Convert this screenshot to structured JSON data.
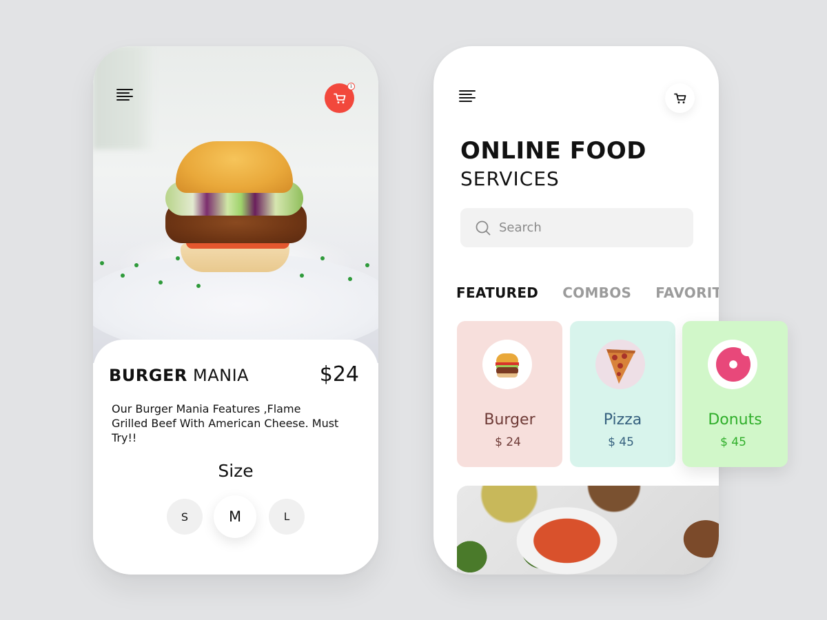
{
  "detail_screen": {
    "menu_icon": "hamburger-menu-icon",
    "cart_icon": "shopping-cart-icon",
    "cart_count": "1",
    "product": {
      "title_bold": "BURGER",
      "title_light": "MANIA",
      "price": "$24",
      "description": "Our Burger Mania Features ,Flame Grilled Beef With American Cheese. Must Try!!"
    },
    "size": {
      "label": "Size",
      "options": [
        "S",
        "M",
        "L"
      ],
      "selected": "M"
    }
  },
  "home_screen": {
    "menu_icon": "hamburger-menu-icon",
    "cart_icon": "shopping-cart-icon",
    "headline_bold": "ONLINE FOOD",
    "headline_light": "SERVICES",
    "search": {
      "placeholder": "Search",
      "value": ""
    },
    "tabs": [
      {
        "label": "FEATURED",
        "active": true
      },
      {
        "label": "COMBOS",
        "active": false
      },
      {
        "label": "FAVORITES",
        "active": false
      }
    ],
    "categories": [
      {
        "name": "Burger",
        "price": "$ 24",
        "bg": "#f7dfdc",
        "color": "#6e3a36"
      },
      {
        "name": "Pizza",
        "price": "$ 45",
        "bg": "#d8f4ec",
        "color": "#35607e"
      },
      {
        "name": "Donuts",
        "price": "$ 45",
        "bg": "#d1f7c9",
        "color": "#2fae2a"
      }
    ]
  },
  "colors": {
    "accent_red": "#f2483c",
    "background": "#e2e3e5"
  }
}
